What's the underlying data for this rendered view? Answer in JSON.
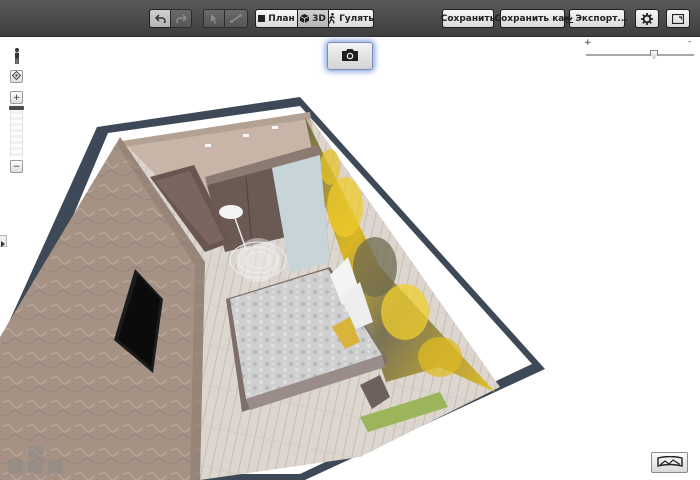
{
  "toolbar": {
    "undo_icon": "undo-icon",
    "redo_icon": "redo-icon",
    "select_icon": "cursor-icon",
    "draw_wall_icon": "line-tool-icon",
    "view_modes": [
      {
        "label": "План",
        "icon": "square-icon"
      },
      {
        "label": "3D",
        "icon": "cube-icon"
      },
      {
        "label": "Гулять",
        "icon": "walking-person-icon"
      }
    ],
    "save_label": "Сохранить",
    "save_as_label": "Сохранить как",
    "export_label": "Экспорт...",
    "export_icon": "download-arrow-icon",
    "settings_icon": "gear-icon",
    "fullscreen_icon": "fullscreen-icon"
  },
  "camera_icon": "camera-icon",
  "zoom": {
    "plus": "+",
    "minus": "-",
    "level": 0.6
  },
  "left_controls": {
    "person_icon": "person-icon",
    "center_icon": "target-icon",
    "zoom_in": "+",
    "zoom_out": "−",
    "expand_icon": "triangle-right-icon"
  },
  "bottom": {
    "view_toggle_icon": "panorama-icon"
  },
  "colors": {
    "toolbar_bg": "#4a4a4a",
    "outer_wall": "#3b4654",
    "wall_left": "#a8968a",
    "floor": "#d8d2ca",
    "bed_cover": "#c9c9c9",
    "wallpaper_yellow": "#e8c320"
  }
}
